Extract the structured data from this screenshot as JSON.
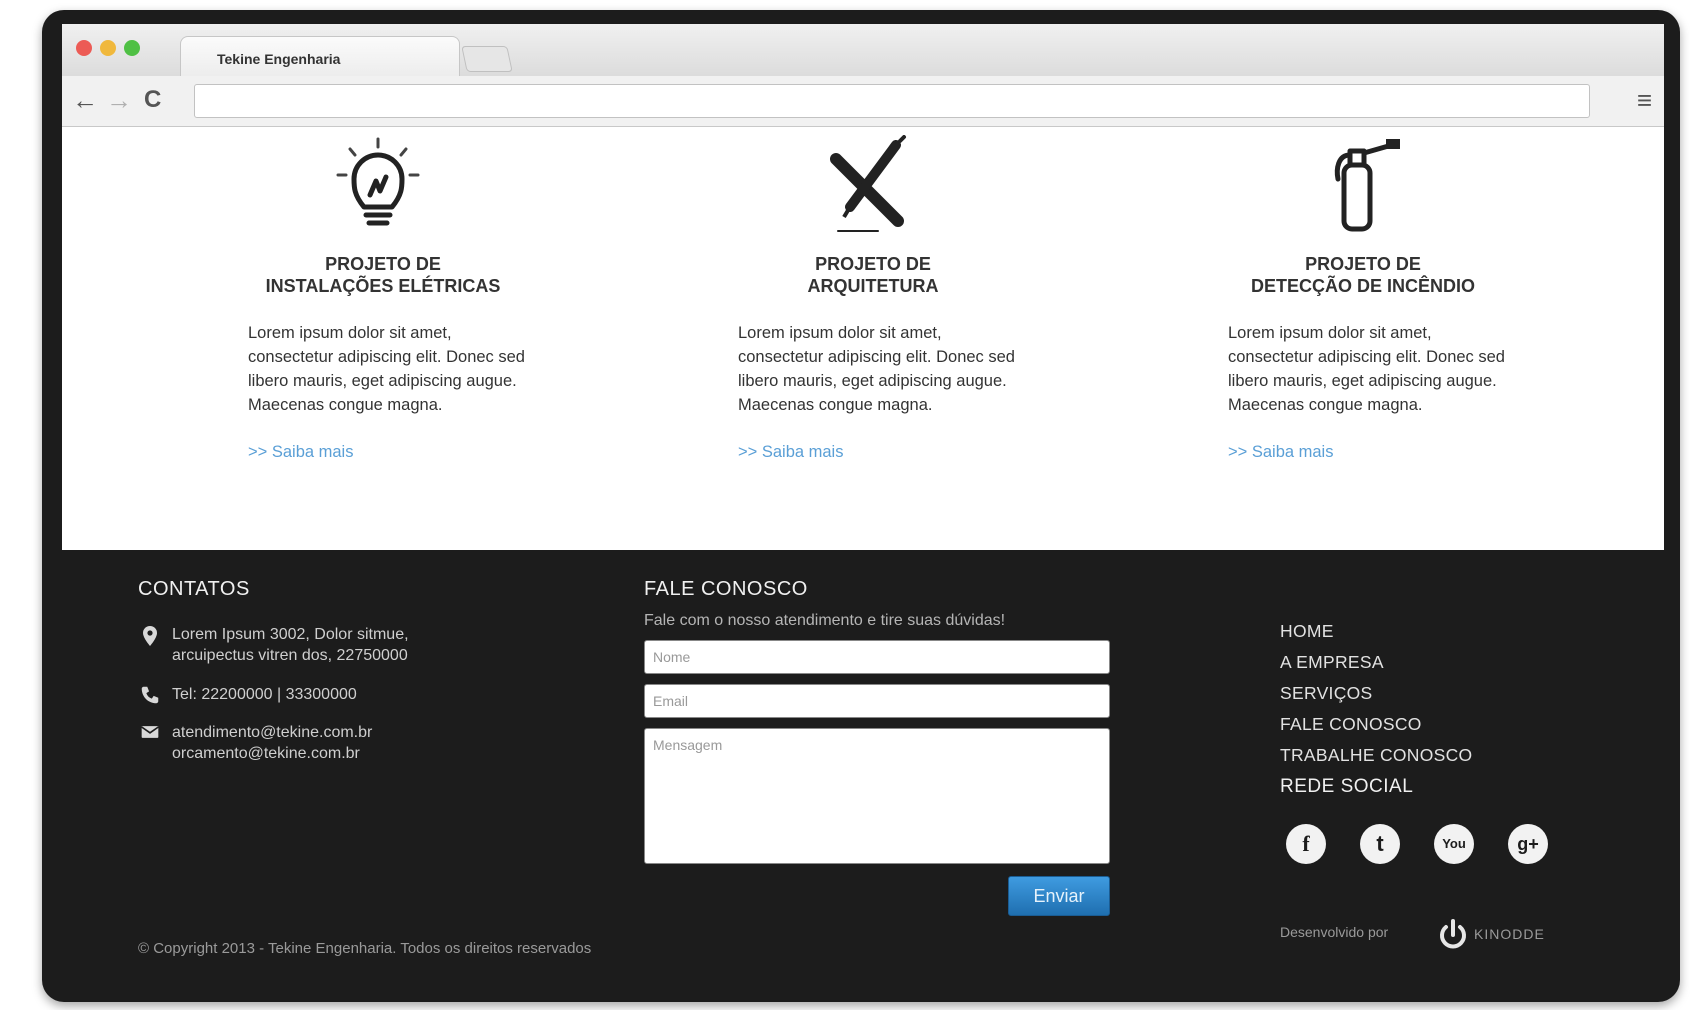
{
  "browser": {
    "tab_title": "Tekine Engenharia",
    "back_icon": "←",
    "forward_icon": "→",
    "reload_icon": "C",
    "menu_icon": "≡",
    "url": ""
  },
  "services": [
    {
      "icon": "lightbulb-icon",
      "title_line1": "PROJETO DE",
      "title_line2": "INSTALAÇÕES ELÉTRICAS",
      "text": "Lorem ipsum dolor sit amet, consectetur adipiscing elit. Donec sed libero mauris, eget adipiscing augue. Maecenas congue magna.",
      "link": ">> Saiba mais"
    },
    {
      "icon": "pencil-ruler-icon",
      "title_line1": "PROJETO DE",
      "title_line2": "ARQUITETURA",
      "text": "Lorem ipsum dolor sit amet, consectetur adipiscing elit. Donec sed libero mauris, eget adipiscing augue. Maecenas congue magna.",
      "link": ">> Saiba mais"
    },
    {
      "icon": "fire-extinguisher-icon",
      "title_line1": "PROJETO DE",
      "title_line2": "DETECÇÃO DE INCÊNDIO",
      "text": "Lorem ipsum dolor sit amet, consectetur adipiscing elit. Donec sed libero mauris, eget adipiscing augue. Maecenas congue magna.",
      "link": ">> Saiba mais"
    }
  ],
  "footer": {
    "contacts": {
      "heading": "CONTATOS",
      "address_line1": "Lorem Ipsum 3002, Dolor sitmue,",
      "address_line2": "arcuipectus vitren dos, 22750000",
      "phone": "Tel: 22200000  |  33300000",
      "email_line1": "atendimento@tekine.com.br",
      "email_line2": "orcamento@tekine.com.br"
    },
    "contact_form": {
      "heading": "FALE CONOSCO",
      "subtitle": "Fale com o nosso atendimento e tire suas dúvidas!",
      "name_placeholder": "Nome",
      "email_placeholder": "Email",
      "message_placeholder": "Mensagem",
      "submit_label": "Enviar"
    },
    "nav": {
      "items": [
        "HOME",
        "A EMPRESA",
        "SERVIÇOS",
        "FALE CONOSCO",
        "TRABALHE CONOSCO"
      ]
    },
    "social": {
      "heading": "REDE SOCIAL",
      "facebook": "f",
      "twitter": "t",
      "youtube": "You",
      "googleplus": "g+"
    },
    "copyright": "© Copyright 2013 - Tekine Engenharia. Todos os direitos reservados",
    "developed_by": "Desenvolvido por",
    "developer": "KINODDE"
  },
  "colors": {
    "footer_bg": "#1c1c1c",
    "link": "#5a9fd6",
    "button": "#2a84c8"
  }
}
